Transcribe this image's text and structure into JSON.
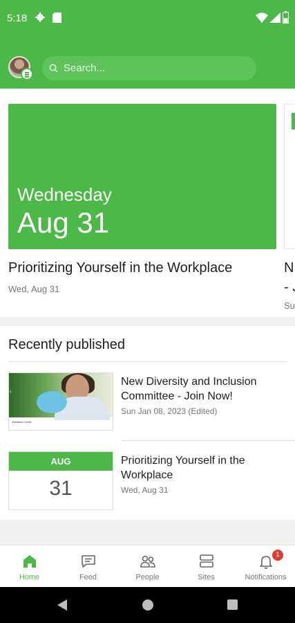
{
  "status_bar": {
    "time": "5:18"
  },
  "search": {
    "placeholder": "Search..."
  },
  "featured": [
    {
      "day": "Wednesday",
      "date": "Aug 31",
      "title": "Prioritizing Yourself in the Workplace",
      "subtitle": "Wed, Aug 31"
    },
    {
      "title_line1": "N",
      "title_line2": "- J",
      "subtitle": "Su"
    }
  ],
  "recent": {
    "heading": "Recently published",
    "items": [
      {
        "title": "New Diversity and Inclusion Committee - Join Now!",
        "subtitle": "Sun Jan 08, 2023 (Edited)",
        "thumb_caption": "Wellness Credit"
      },
      {
        "title": "Prioritizing Yourself in the Workplace",
        "subtitle": "Wed, Aug 31",
        "cal_month": "AUG",
        "cal_day": "31"
      }
    ]
  },
  "bottom_nav": {
    "items": [
      {
        "label": "Home",
        "icon": "home-icon",
        "active": true
      },
      {
        "label": "Feed",
        "icon": "feed-icon"
      },
      {
        "label": "People",
        "icon": "people-icon"
      },
      {
        "label": "Sites",
        "icon": "sites-icon"
      },
      {
        "label": "Notifications",
        "icon": "bell-icon",
        "badge": "1"
      }
    ]
  },
  "colors": {
    "brand_green": "#4cb848",
    "badge_red": "#e53935"
  }
}
